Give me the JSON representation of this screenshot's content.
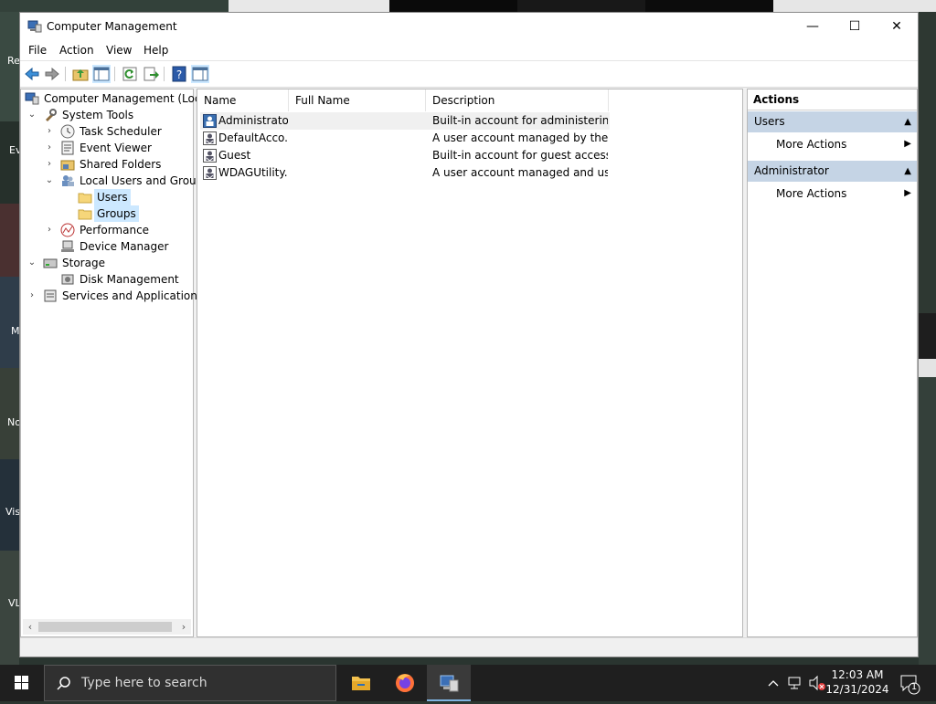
{
  "window": {
    "title": "Computer Management",
    "minimize_glyph": "—",
    "maximize_glyph": "☐",
    "close_glyph": "✕"
  },
  "menu": [
    "File",
    "Action",
    "View",
    "Help"
  ],
  "toolbar": {
    "icons": [
      "back-icon",
      "forward-icon",
      "up-folder-icon",
      "show-hide-tree-icon",
      "refresh-icon",
      "export-list-icon",
      "help-icon",
      "show-hide-action-pane-icon"
    ]
  },
  "tree": {
    "root": "Computer Management (Local",
    "system_tools": "System Tools",
    "task_scheduler": "Task Scheduler",
    "event_viewer": "Event Viewer",
    "shared_folders": "Shared Folders",
    "local_users_groups": "Local Users and Groups",
    "users": "Users",
    "groups": "Groups",
    "performance": "Performance",
    "device_manager": "Device Manager",
    "storage": "Storage",
    "disk_management": "Disk Management",
    "services_apps": "Services and Applications"
  },
  "list": {
    "columns": [
      "Name",
      "Full Name",
      "Description"
    ],
    "rows": [
      {
        "name": "Administrator",
        "full_name": "",
        "description": "Built-in account for administering..."
      },
      {
        "name": "DefaultAcco...",
        "full_name": "",
        "description": "A user account managed by the s..."
      },
      {
        "name": "Guest",
        "full_name": "",
        "description": "Built-in account for guest access t..."
      },
      {
        "name": "WDAGUtility...",
        "full_name": "",
        "description": "A user account managed and use..."
      }
    ]
  },
  "actions": {
    "header": "Actions",
    "section1": "Users",
    "section1_item": "More Actions",
    "section2": "Administrator",
    "section2_item": "More Actions"
  },
  "desktop_labels": [
    "Re",
    "Ev",
    "M",
    "No",
    "Vis",
    "VL"
  ],
  "taskbar": {
    "search_placeholder": "Type here to search",
    "time": "12:03 AM",
    "date": "12/31/2024",
    "notification_count": "1"
  },
  "colors": {
    "selection": "#cce8ff",
    "action_section": "#c5d4e5",
    "taskbar": "#1f1f1f"
  }
}
